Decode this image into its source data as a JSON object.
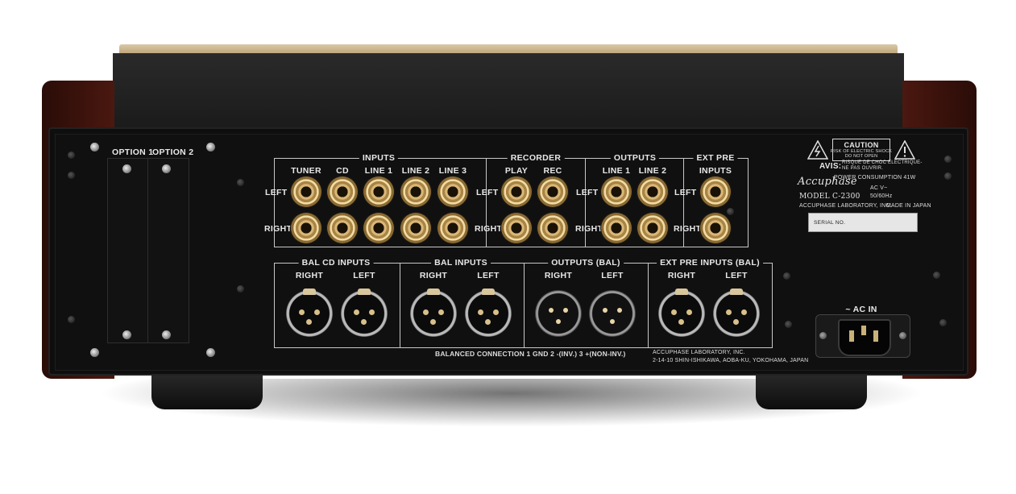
{
  "option_slots": {
    "option1": "OPTION 1",
    "option2": "OPTION 2"
  },
  "rca_section": {
    "inputs_title": "INPUTS",
    "recorder_title": "RECORDER",
    "outputs_title": "OUTPUTS",
    "ext_pre_title": "EXT PRE",
    "ext_pre_sub": "INPUTS",
    "inputs": [
      "TUNER",
      "CD",
      "LINE 1",
      "LINE 2",
      "LINE 3"
    ],
    "recorder": [
      "PLAY",
      "REC"
    ],
    "outputs": [
      "LINE 1",
      "LINE 2"
    ],
    "left": "LEFT",
    "right": "RIGHT"
  },
  "bal_section": {
    "bal_cd_inputs": "BAL CD  INPUTS",
    "bal_inputs": "BAL  INPUTS",
    "outputs_bal": "OUTPUTS (BAL)",
    "ext_pre_bal": "EXT PRE INPUTS (BAL)",
    "right": "RIGHT",
    "left": "LEFT",
    "balanced_connection": "BALANCED CONNECTION    1 GND    2 -(INV.)    3 +(NON-INV.)"
  },
  "address": {
    "line1": "ACCUPHASE LABORATORY, INC.",
    "line2": "2-14-10 SHIN-ISHIKAWA, AOBA-KU, YOKOHAMA, JAPAN"
  },
  "label_plate": {
    "caution": "CAUTION",
    "risk": "RISK OF ELECTRIC SHOCK",
    "do_not_open": "DO NOT OPEN",
    "avis": "AVIS:",
    "avis_text1": "RISQUE DE CHOC ELECTRIQUE-",
    "avis_text2": "NE PAS OUVRIR.",
    "power": "POWER CONSUMPTION  41W",
    "brand": "Accuphase",
    "ac": "AC      V~",
    "hz": "50/60Hz",
    "model": "MODEL  C-2300",
    "company": "ACCUPHASE LABORATORY, INC.",
    "made_in": "MADE IN JAPAN",
    "serial": "SERIAL NO."
  },
  "ac_in": "~ AC IN"
}
